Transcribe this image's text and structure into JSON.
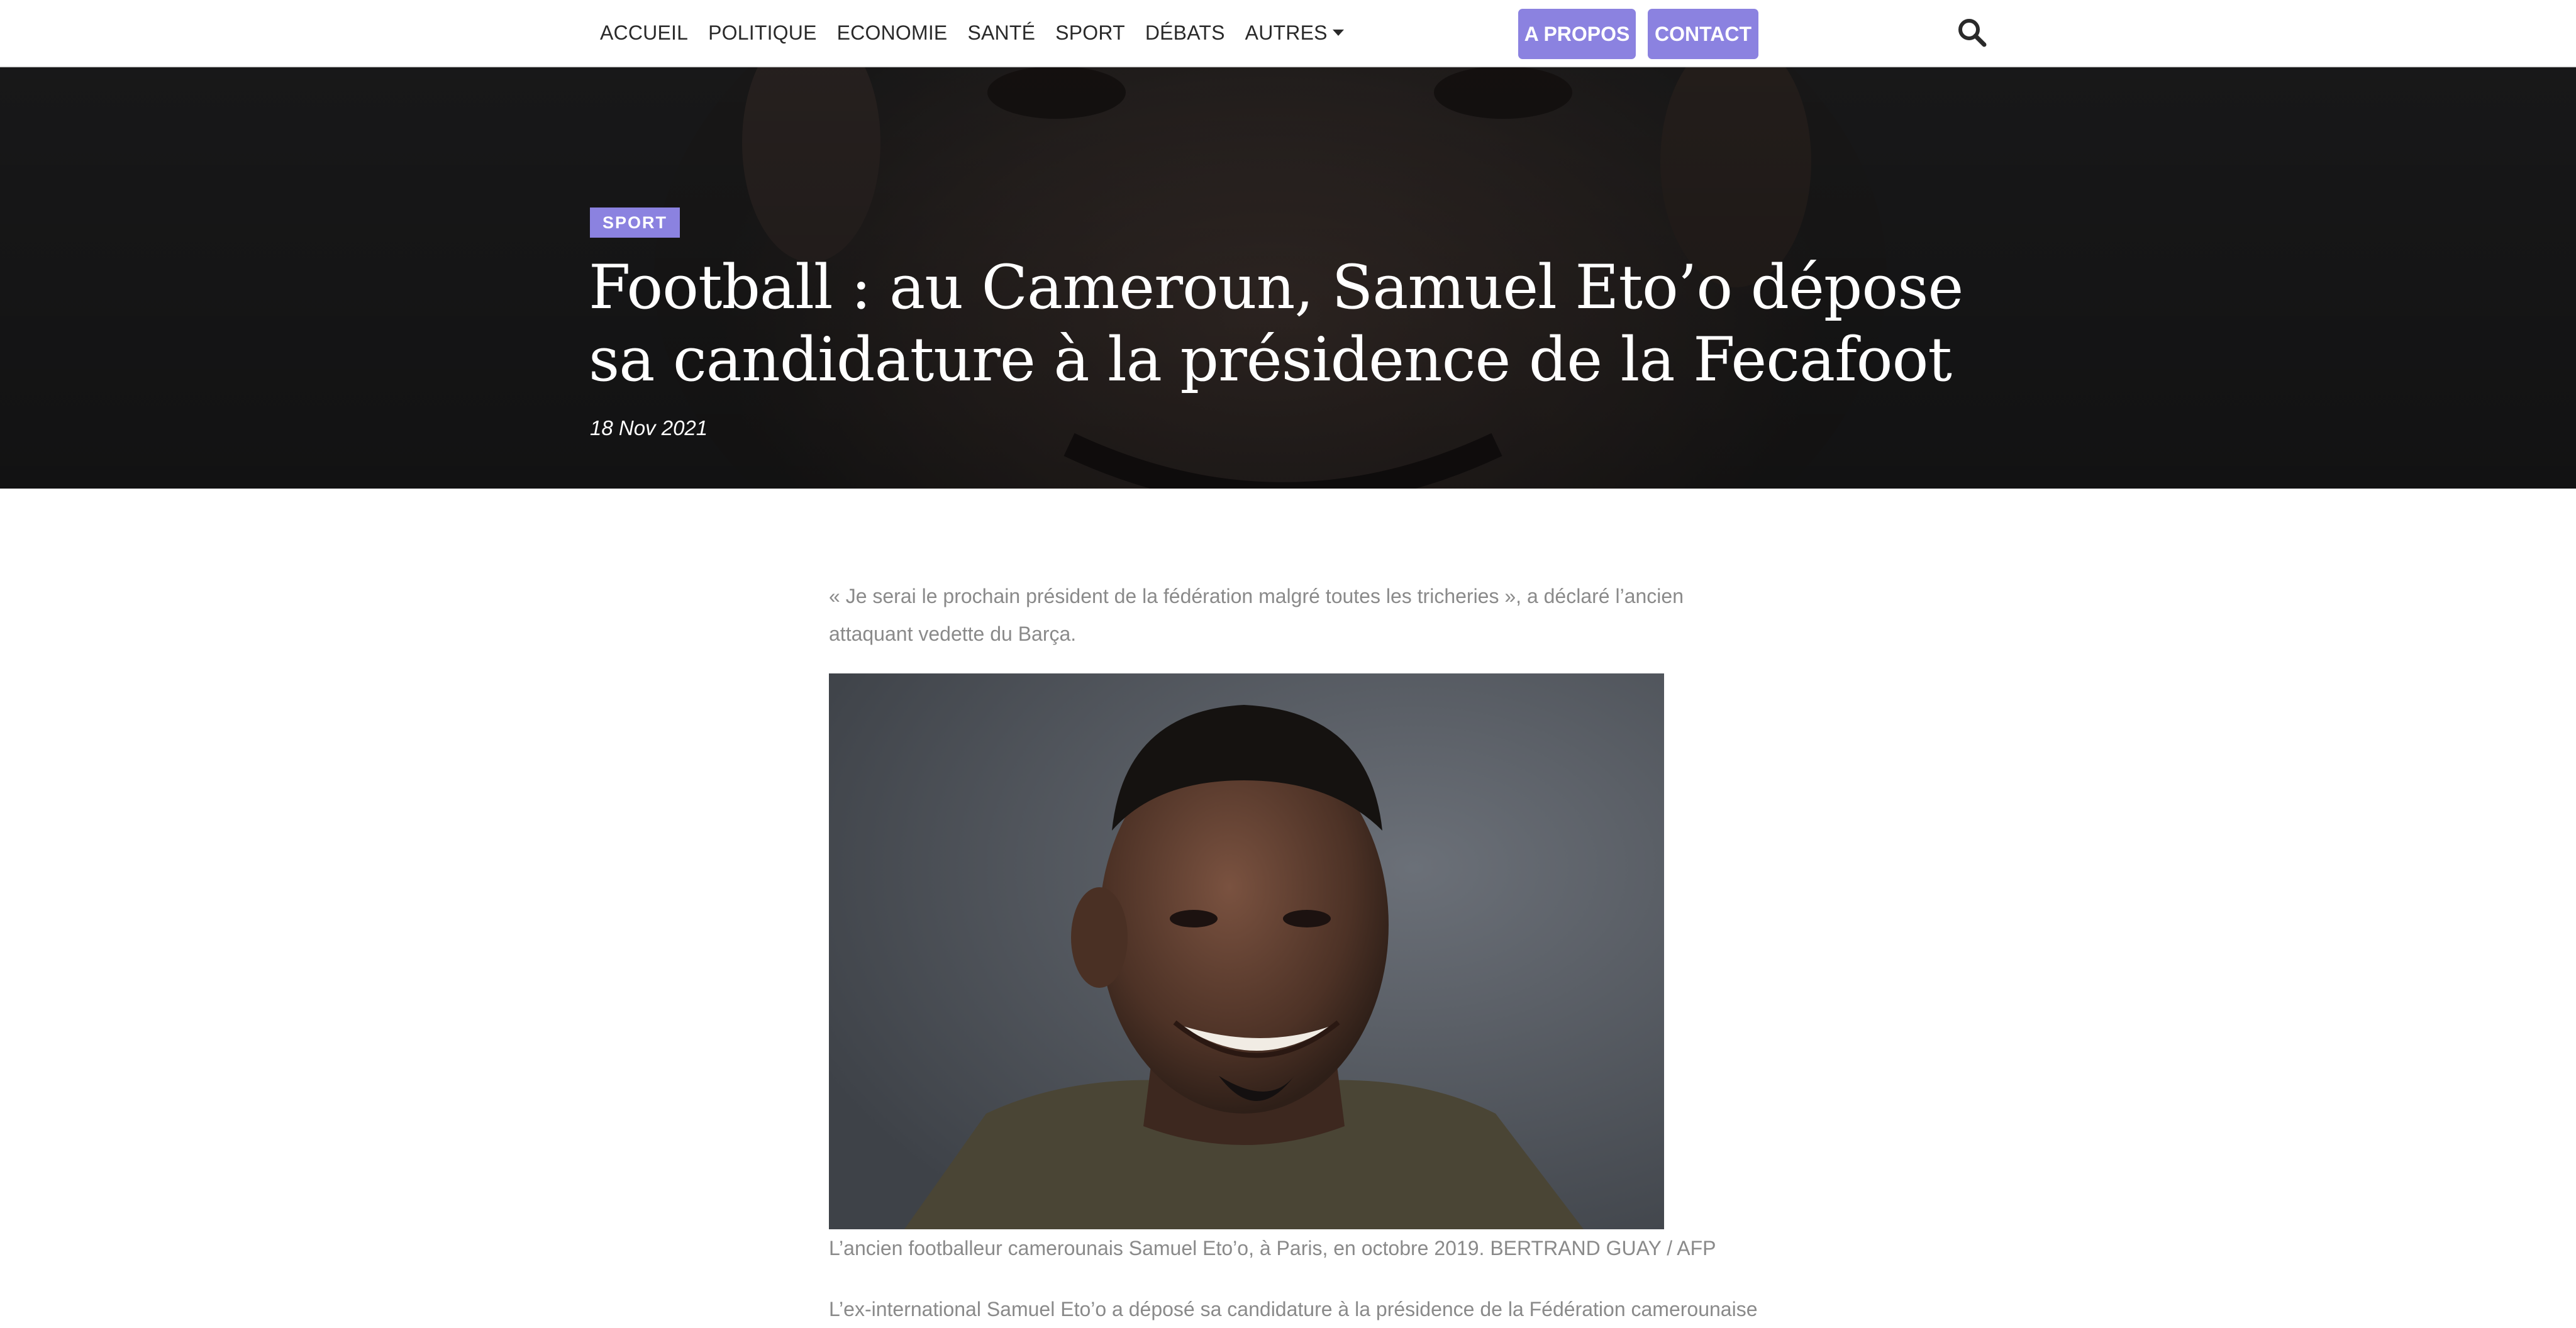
{
  "nav": {
    "items": [
      {
        "label": "ACCUEIL"
      },
      {
        "label": "POLITIQUE"
      },
      {
        "label": "ECONOMIE"
      },
      {
        "label": "SANTÉ"
      },
      {
        "label": "SPORT"
      },
      {
        "label": "DÉBATS"
      },
      {
        "label": "AUTRES"
      }
    ],
    "apropos_label": "A PROPOS",
    "contact_label": "CONTACT",
    "search_icon": "search-icon"
  },
  "hero": {
    "category": "SPORT",
    "title": "Football : au Cameroun, Samuel Eto’o dépose sa candidature à la présidence de la Fecafoot",
    "date": "18 Nov 2021"
  },
  "article": {
    "lead": "« Je serai le prochain président de la fédération malgré toutes les tricheries », a déclaré l’ancien attaquant vedette du Barça.",
    "photo_caption": "L’ancien footballeur camerounais Samuel Eto’o, à Paris, en octobre 2019. BERTRAND GUAY / AFP",
    "body_first_line": "L’ex-international Samuel Eto’o a déposé sa candidature à la présidence de la Fédération camerounaise"
  },
  "colors": {
    "accent": "#8b82e0",
    "nav_text": "#2a2a2a",
    "body_text": "#8a8a8a",
    "hero_overlay": "#1b1b1b"
  }
}
